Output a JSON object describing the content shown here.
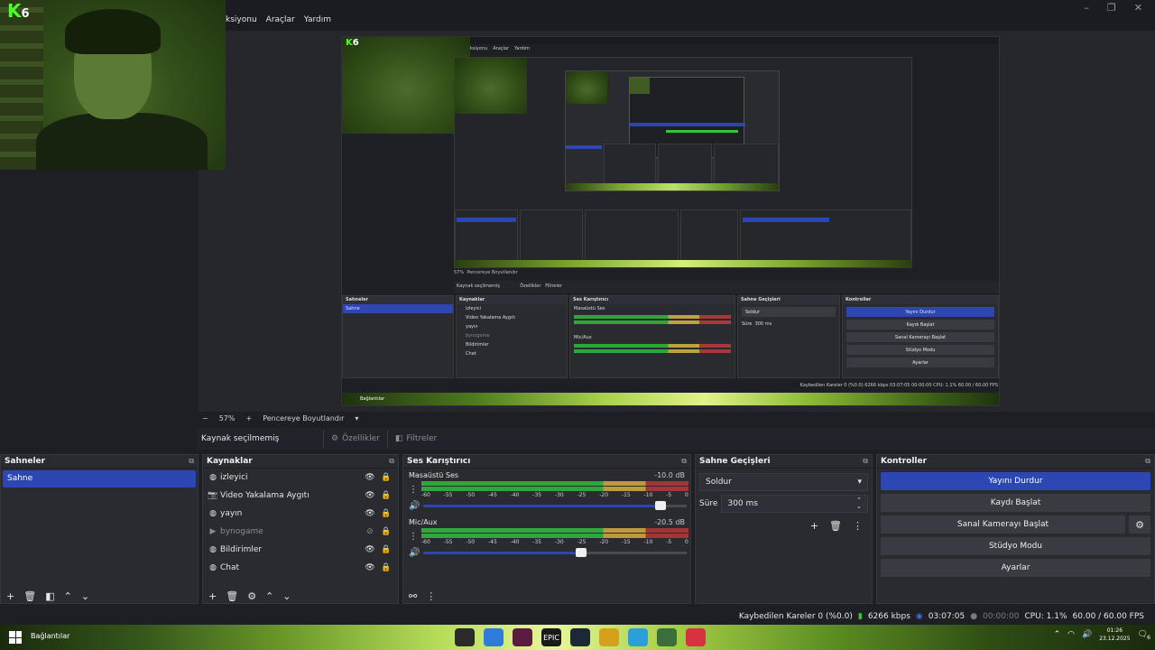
{
  "window": {
    "menu": [
      "ksiyonu",
      "Araçlar",
      "Yardım"
    ]
  },
  "webcam_logo": {
    "k": "K",
    "n": "6"
  },
  "nested": {
    "menu": [
      "ksiyonu",
      "Araçlar",
      "Yardım"
    ],
    "zoom": "57%",
    "fit": "Pencereye Boyutlandır",
    "source_none": "Kaynak seçilmemiş",
    "props": "Özellikler",
    "filters": "Filtreler",
    "scenes_title": "Sahneler",
    "scene": "Sahne",
    "sources_title": "Kaynaklar",
    "sources": [
      "izleyici",
      "Video Yakalama Aygıtı",
      "yayın",
      "bynogame",
      "Bildirimler",
      "Chat"
    ],
    "mixer_title": "Ses Karıştırıcı",
    "ch1": "Masaüstü Ses",
    "ch2": "Mic/Aux",
    "trans_title": "Sahne Geçişleri",
    "trans": "Soldur",
    "dur_label": "Süre",
    "dur": "300 ms",
    "controls_title": "Kontroller",
    "buttons": [
      "Yayını Durdur",
      "Kaydı Başlat",
      "Sanal Kamerayı Başlat",
      "Stüdyo Modu",
      "Ayarlar"
    ],
    "status": "Kaybedilen Kareler 0 (%0.0)   6266 kbps   03:07:05   00:00:00   CPU: 1.1%   60.00 / 60.00 FPS",
    "taskbar_label": "Bağlantılar"
  },
  "zoombar": {
    "minus": "−",
    "zoom": "57%",
    "plus": "+",
    "fit": "Pencereye Boyutlandır"
  },
  "sourcebar": {
    "label": "Kaynak seçilmemiş",
    "properties": "Özellikler",
    "filters": "Filtreler"
  },
  "scenes": {
    "title": "Sahneler",
    "items": [
      {
        "label": "Sahne"
      }
    ]
  },
  "sources": {
    "title": "Kaynaklar",
    "items": [
      {
        "label": "izleyici",
        "icon": "globe-icon",
        "visible": true
      },
      {
        "label": "Video Yakalama Aygıtı",
        "icon": "camera-icon",
        "visible": true
      },
      {
        "label": "yayın",
        "icon": "globe-icon",
        "visible": true
      },
      {
        "label": "bynogame",
        "icon": "play-icon",
        "visible": false
      },
      {
        "label": "Bildirimler",
        "icon": "globe-icon",
        "visible": true
      },
      {
        "label": "Chat",
        "icon": "globe-icon",
        "visible": true
      }
    ]
  },
  "mixer": {
    "title": "Ses Karıştırıcı",
    "ticks": [
      "-60",
      "-55",
      "-50",
      "-45",
      "-40",
      "-35",
      "-30",
      "-25",
      "-20",
      "-15",
      "-10",
      "-5",
      "0"
    ],
    "channels": [
      {
        "name": "Masaüstü Ses",
        "db": "-10.0 dB",
        "volume": 0.9
      },
      {
        "name": "Mic/Aux",
        "db": "-20.5 dB",
        "volume": 0.6
      }
    ]
  },
  "transitions": {
    "title": "Sahne Geçişleri",
    "selected": "Soldur",
    "duration_label": "Süre",
    "duration": "300 ms"
  },
  "controls": {
    "title": "Kontroller",
    "stop_stream": "Yayını Durdur",
    "start_record": "Kaydı Başlat",
    "virtual_cam": "Sanal Kamerayı Başlat",
    "studio_mode": "Stüdyo Modu",
    "settings": "Ayarlar"
  },
  "status": {
    "dropped": "Kaybedilen Kareler 0 (%0.0)",
    "bitrate": "6266 kbps",
    "stream_time": "03:07:05",
    "record_time": "00:00:00",
    "cpu": "CPU: 1.1%",
    "fps": "60.00 / 60.00 FPS"
  },
  "taskbar": {
    "label": "Bağlantılar",
    "apps": [
      {
        "icon": "obs-icon",
        "color": "#2b2b2b"
      },
      {
        "icon": "chrome-icon",
        "color": "#2f7bd9"
      },
      {
        "icon": "deco-icon",
        "color": "#5b1d3d"
      },
      {
        "icon": "epic-icon",
        "color": "#1a1a1a",
        "text": "EPIC"
      },
      {
        "icon": "steam-icon",
        "color": "#1b2838"
      },
      {
        "icon": "opera-icon",
        "color": "#d6a11a"
      },
      {
        "icon": "telegram-icon",
        "color": "#2a9fd8"
      },
      {
        "icon": "chrome-alt-icon",
        "color": "#3a6e3a"
      },
      {
        "icon": "vivaldi-icon",
        "color": "#d6323f"
      }
    ],
    "time": "01:26",
    "date": "23.12.2025",
    "notifications": "6"
  },
  "colors": {
    "accent": "#2c46b4",
    "meter_green": "#2ea83c",
    "meter_yellow": "#bd9a3a",
    "meter_red": "#a53434"
  }
}
